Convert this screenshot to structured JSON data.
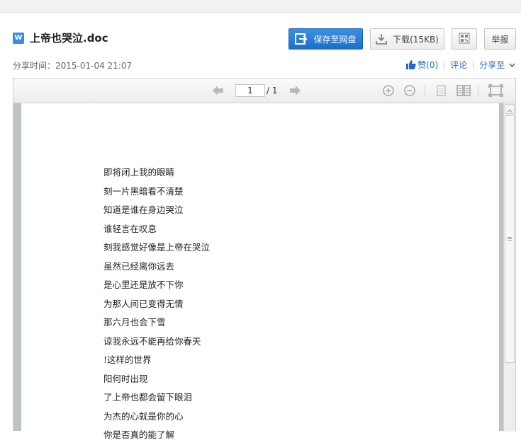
{
  "header": {
    "file_icon_letter": "W",
    "title": "上帝也哭泣.doc",
    "save_label": "保存至网盘",
    "download_label": "下载(15KB)",
    "report_label": "举报",
    "share_time": "分享时间：2015-01-04 21:07",
    "like_label": "赞(0)",
    "comment_label": "评论",
    "share_label": "分享至"
  },
  "viewer": {
    "current_page": "1",
    "total_pages": "/ 1"
  },
  "document": {
    "lines": [
      "即将闭上我的眼睛",
      "刻一片黑暗看不清楚",
      "知道是谁在身边哭泣",
      "谁轻言在叹息",
      "刻我感觉好像是上帝在哭泣",
      "虽然已经离你远去",
      "是心里还是放不下你",
      "为那人间已变得无情",
      "那六月也会下雪",
      "谅我永远不能再给你春天",
      "!这样的世界",
      "阳何时出现",
      "了上帝也都会留下眼泪",
      "为杰的心就是你的心",
      "你是否真的能了解"
    ]
  },
  "colors": {
    "accent": "#1c6fc9",
    "link": "#1f6cc5",
    "viewer_bg": "#bcc5c0"
  },
  "icons": {
    "file": "word-file-icon",
    "save": "save-to-cloud-icon",
    "download": "download-icon",
    "qr": "qr-code-icon",
    "like": "thumbs-up-icon",
    "prev": "prev-page-icon",
    "next": "next-page-icon",
    "zoom_in": "zoom-in-icon",
    "zoom_out": "zoom-out-icon",
    "single_page": "single-page-view-icon",
    "double_page": "double-page-view-icon",
    "fullscreen": "fullscreen-icon"
  }
}
